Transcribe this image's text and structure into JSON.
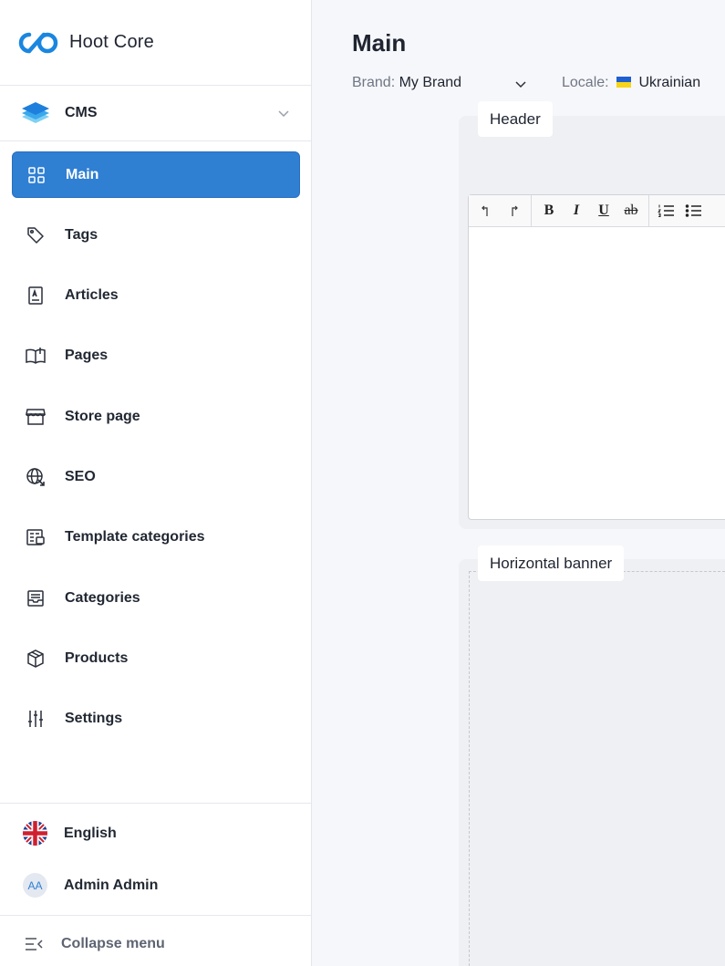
{
  "app": {
    "name": "Hoot Core"
  },
  "module": {
    "label": "CMS"
  },
  "nav": [
    {
      "label": "Main",
      "icon": "grid-icon",
      "active": true
    },
    {
      "label": "Tags",
      "icon": "tag-icon"
    },
    {
      "label": "Articles",
      "icon": "article-icon"
    },
    {
      "label": "Pages",
      "icon": "book-icon"
    },
    {
      "label": "Store page",
      "icon": "store-icon"
    },
    {
      "label": "SEO",
      "icon": "globe-icon"
    },
    {
      "label": "Template categories",
      "icon": "template-icon"
    },
    {
      "label": "Categories",
      "icon": "category-icon"
    },
    {
      "label": "Products",
      "icon": "box-icon"
    },
    {
      "label": "Settings",
      "icon": "sliders-icon"
    }
  ],
  "footer": {
    "language": "English",
    "user": {
      "name": "Admin Admin",
      "initials": "AA"
    },
    "collapse": "Collapse menu"
  },
  "page": {
    "title": "Main",
    "brand_label": "Brand:",
    "brand_value": "My Brand",
    "locale_label": "Locale:",
    "locale_value": "Ukrainian"
  },
  "sections": {
    "header": "Header",
    "banner": "Horizontal banner"
  },
  "toolbar": {
    "undo": "↶",
    "redo": "↷",
    "bold": "B",
    "italic": "I",
    "underline": "U",
    "strike": "ab"
  },
  "colors": {
    "accent": "#2f7fd3",
    "ua_blue": "#1f5fd0",
    "ua_yellow": "#f7d417"
  }
}
